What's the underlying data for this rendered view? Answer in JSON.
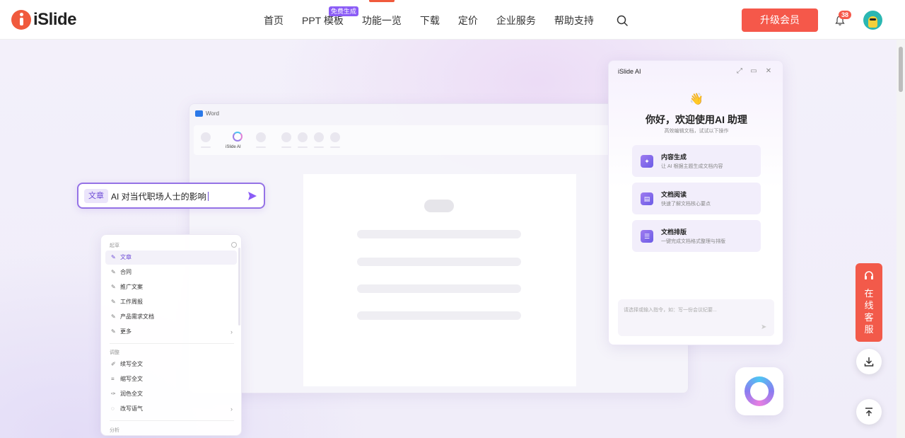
{
  "header": {
    "logo_text": "iSlide",
    "nav": [
      {
        "label": "首页"
      },
      {
        "label": "PPT 模板",
        "badge": "免费生成"
      },
      {
        "label": "功能一览"
      },
      {
        "label": "下载"
      },
      {
        "label": "定价"
      },
      {
        "label": "企业服务"
      },
      {
        "label": "帮助支持"
      }
    ],
    "upgrade_label": "升级会员",
    "notification_count": "38"
  },
  "word_window": {
    "title": "Word",
    "ribbon_ai_label": "iSlide AI"
  },
  "prompt": {
    "tag": "文章",
    "text": "AI 对当代职场人士的影响"
  },
  "menu": {
    "section_draft": "起草",
    "draft_items": [
      "文章",
      "合同",
      "推广文案",
      "工作周报",
      "产品需求文档",
      "更多"
    ],
    "section_adjust": "调整",
    "adjust_items": [
      "续写全文",
      "缩写全文",
      "润色全文",
      "改写语气"
    ],
    "section_analyze": "分析"
  },
  "ai_panel": {
    "title": "iSlide AI",
    "wave": "👋",
    "greeting": "你好，欢迎使用AI 助理",
    "subtitle": "高效编辑文档，试试以下操作",
    "cards": [
      {
        "title": "内容生成",
        "desc": "让 AI 根据主题生成文档内容"
      },
      {
        "title": "文档阅读",
        "desc": "快速了解文档核心要点"
      },
      {
        "title": "文档排版",
        "desc": "一键完成文档格式整理与排版"
      }
    ],
    "input_placeholder": "请选择或输入指令，如：写一份会议纪要..."
  },
  "side_tools": {
    "customer_service": "在线客服"
  },
  "colors": {
    "accent": "#f5584a",
    "ai_purple": "#8b5cf6"
  }
}
